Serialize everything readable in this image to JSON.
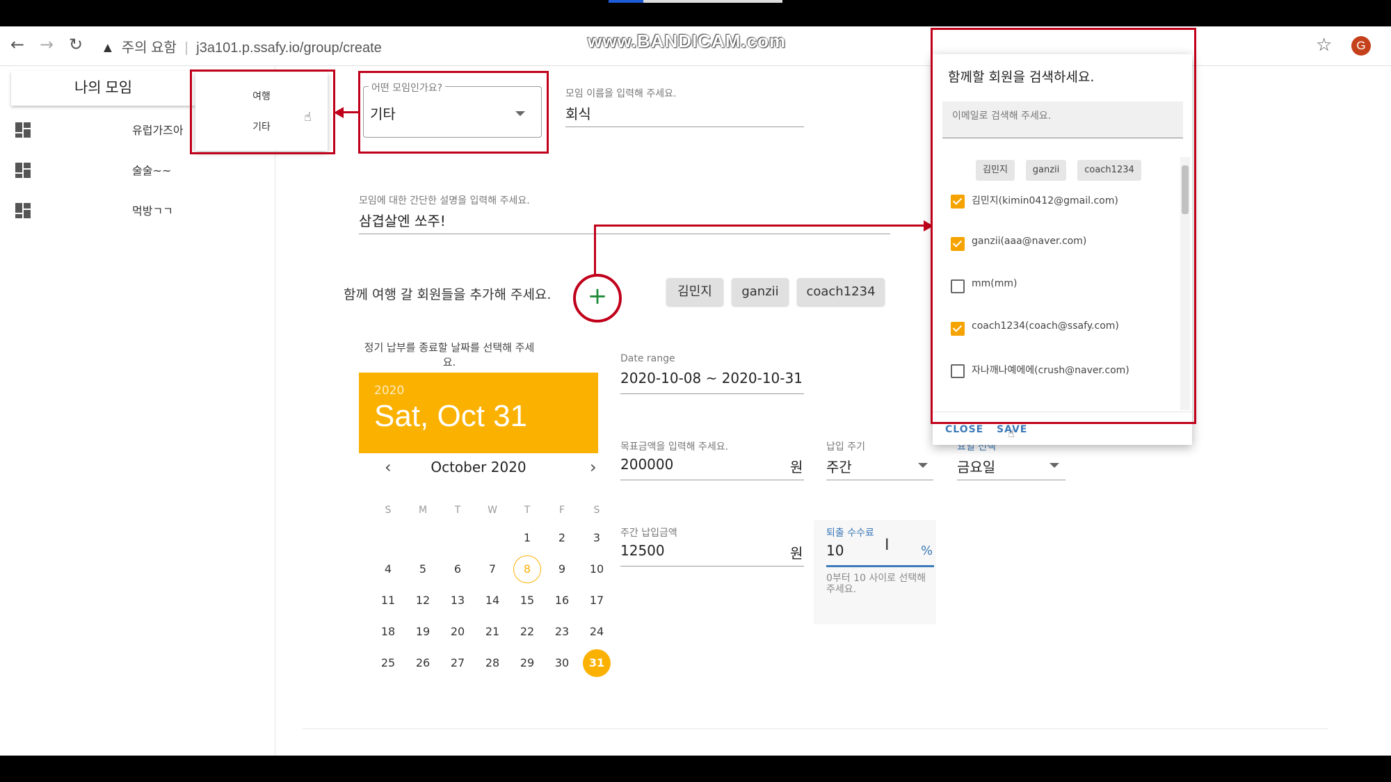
{
  "browser": {
    "warning": "주의 요함",
    "separator": "|",
    "url": "j3a101.p.ssafy.io/group/create",
    "watermark": "www.BANDICAM.com",
    "profile_initial": "G"
  },
  "sidebar": {
    "header": "나의 모임",
    "items": [
      {
        "label": "유럽가즈아"
      },
      {
        "label": "술술~~"
      },
      {
        "label": "먹방ㄱㄱ"
      }
    ]
  },
  "category_menu": {
    "items": [
      "여행",
      "기타"
    ]
  },
  "form": {
    "type_label": "어떤 모임인가요?",
    "type_value": "기타",
    "name_label": "모임 이름을 입력해 주세요.",
    "name_value": "회식",
    "desc_label": "모임에 대한 간단한 설명을 입력해 주세요.",
    "desc_value": "삼겹살엔 쏘주!",
    "members_prompt": "함께 여행 갈 회원들을 추가해 주세요.",
    "add_icon": "+",
    "member_chips": [
      "김민지",
      "ganzii",
      "coach1234"
    ],
    "end_date_prompt": "정기 납부를 종료할 날짜를 선택해 주세요.",
    "date_range_label": "Date range",
    "date_range_value": "2020-10-08 ~ 2020-10-31",
    "goal_label": "목표금액을 입력해 주세요.",
    "goal_value": "200000",
    "goal_unit": "원",
    "cycle_label": "납입 주기",
    "cycle_value": "주간",
    "weekday_label": "요일 선택",
    "weekday_value": "금요일",
    "weekly_amount_label": "주간 납입금액",
    "weekly_amount_value": "12500",
    "weekly_amount_unit": "원",
    "fee_label": "퇴출 수수료",
    "fee_value": "10",
    "fee_unit": "%",
    "fee_hint": "0부터 10 사이로 선택해 주세요."
  },
  "datepicker": {
    "year": "2020",
    "selected_display": "Sat, Oct 31",
    "month_label": "October 2020",
    "prev": "‹",
    "next": "›",
    "weekdays": [
      "S",
      "M",
      "T",
      "W",
      "T",
      "F",
      "S"
    ],
    "first_weekday_index": 4,
    "days_in_month": 31,
    "today": 8,
    "selected": 31
  },
  "member_dialog": {
    "title": "함께할 회원을 검색하세요.",
    "search_placeholder": "이메일로 검색해 주세요.",
    "selected_chips": [
      "김민지",
      "ganzii",
      "coach1234"
    ],
    "members": [
      {
        "label": "김민지(kimin0412@gmail.com)",
        "checked": true
      },
      {
        "label": "ganzii(aaa@naver.com)",
        "checked": true
      },
      {
        "label": "mm(mm)",
        "checked": false
      },
      {
        "label": "coach1234(coach@ssafy.com)",
        "checked": true
      },
      {
        "label": "자나깨나예에에(crush@naver.com)",
        "checked": false
      }
    ],
    "close_label": "CLOSE",
    "save_label": "SAVE"
  },
  "colors": {
    "accent": "#fbb100",
    "annotation_red": "#c0001a",
    "link_blue": "#3b79b8"
  }
}
